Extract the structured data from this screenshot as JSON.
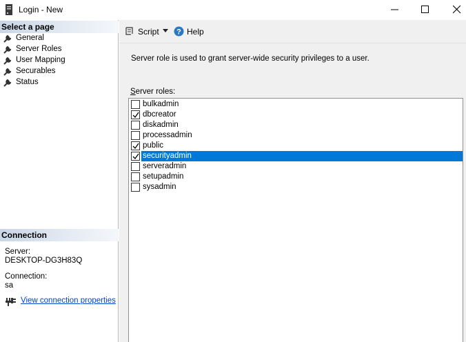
{
  "window": {
    "title": "Login - New"
  },
  "left": {
    "select_page_header": "Select a page",
    "pages": [
      {
        "label": "General",
        "selected": false
      },
      {
        "label": "Server Roles",
        "selected": true
      },
      {
        "label": "User Mapping",
        "selected": false
      },
      {
        "label": "Securables",
        "selected": false
      },
      {
        "label": "Status",
        "selected": false
      }
    ],
    "connection_header": "Connection",
    "server_label": "Server:",
    "server_value": "DESKTOP-DG3H83Q",
    "connection_label": "Connection:",
    "connection_value": "sa",
    "view_link": "View connection properties"
  },
  "toolbar": {
    "script_label": "Script",
    "help_label": "Help"
  },
  "content": {
    "description": "Server role is used to grant server-wide security privileges to a user.",
    "roles_label_underlined": "S",
    "roles_label_rest": "erver roles:",
    "roles": [
      {
        "name": "bulkadmin",
        "checked": false,
        "selected": false
      },
      {
        "name": "dbcreator",
        "checked": true,
        "selected": false
      },
      {
        "name": "diskadmin",
        "checked": false,
        "selected": false
      },
      {
        "name": "processadmin",
        "checked": false,
        "selected": false
      },
      {
        "name": "public",
        "checked": true,
        "selected": false
      },
      {
        "name": "securityadmin",
        "checked": true,
        "selected": true
      },
      {
        "name": "serveradmin",
        "checked": false,
        "selected": false
      },
      {
        "name": "setupadmin",
        "checked": false,
        "selected": false
      },
      {
        "name": "sysadmin",
        "checked": false,
        "selected": false
      }
    ]
  },
  "colors": {
    "selection": "#0078d7",
    "link": "#0044cc",
    "header_gradient": "#c9d6e6",
    "help_icon": "#2b78c2"
  }
}
